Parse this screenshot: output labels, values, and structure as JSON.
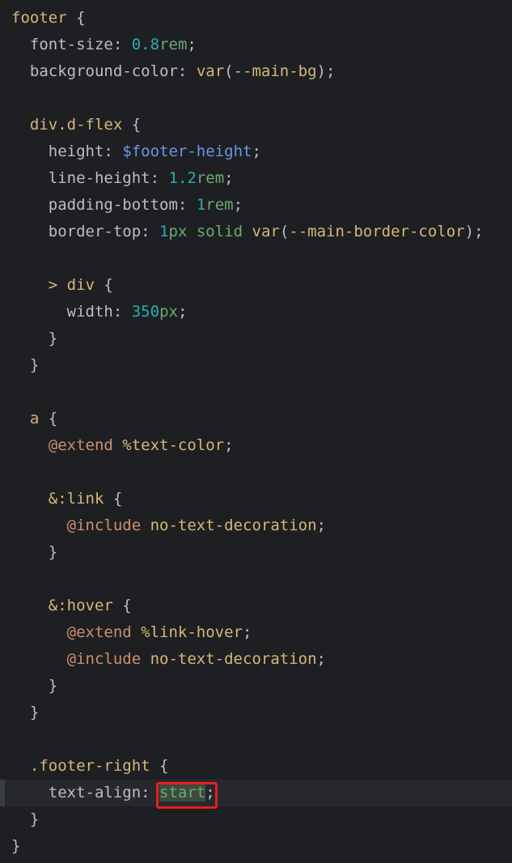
{
  "colors": {
    "background": "#1e1f22",
    "current_line": "#26282e",
    "selector": "#d5b778",
    "property": "#bcbec4",
    "number": "#2aacb8",
    "keyword_value": "#6aab73",
    "scss_variable": "#6c95eb",
    "at_rule": "#cf8e6d",
    "highlight_box": "#e8201c"
  },
  "lines": [
    {
      "indent": "",
      "tokens": [
        {
          "t": "footer",
          "c": "sel"
        },
        {
          "t": " {",
          "c": "punc"
        }
      ]
    },
    {
      "indent": "  ",
      "tokens": [
        {
          "t": "font-size",
          "c": "prop"
        },
        {
          "t": ": ",
          "c": "punc"
        },
        {
          "t": "0.8",
          "c": "num"
        },
        {
          "t": "rem",
          "c": "val"
        },
        {
          "t": ";",
          "c": "punc"
        }
      ]
    },
    {
      "indent": "  ",
      "tokens": [
        {
          "t": "background-color",
          "c": "prop"
        },
        {
          "t": ": ",
          "c": "punc"
        },
        {
          "t": "var",
          "c": "fn"
        },
        {
          "t": "(",
          "c": "punc"
        },
        {
          "t": "--main-bg",
          "c": "ident"
        },
        {
          "t": ");",
          "c": "punc"
        }
      ]
    },
    {
      "indent": "",
      "tokens": []
    },
    {
      "indent": "  ",
      "tokens": [
        {
          "t": "div.d-flex",
          "c": "sel"
        },
        {
          "t": " {",
          "c": "punc"
        }
      ]
    },
    {
      "indent": "    ",
      "tokens": [
        {
          "t": "height",
          "c": "prop"
        },
        {
          "t": ": ",
          "c": "punc"
        },
        {
          "t": "$footer-height",
          "c": "var"
        },
        {
          "t": ";",
          "c": "punc"
        }
      ]
    },
    {
      "indent": "    ",
      "tokens": [
        {
          "t": "line-height",
          "c": "prop"
        },
        {
          "t": ": ",
          "c": "punc"
        },
        {
          "t": "1.2",
          "c": "num"
        },
        {
          "t": "rem",
          "c": "val"
        },
        {
          "t": ";",
          "c": "punc"
        }
      ]
    },
    {
      "indent": "    ",
      "tokens": [
        {
          "t": "padding-bottom",
          "c": "prop"
        },
        {
          "t": ": ",
          "c": "punc"
        },
        {
          "t": "1",
          "c": "num"
        },
        {
          "t": "rem",
          "c": "val"
        },
        {
          "t": ";",
          "c": "punc"
        }
      ]
    },
    {
      "indent": "    ",
      "tokens": [
        {
          "t": "border-top",
          "c": "prop"
        },
        {
          "t": ": ",
          "c": "punc"
        },
        {
          "t": "1",
          "c": "num"
        },
        {
          "t": "px",
          "c": "val"
        },
        {
          "t": " ",
          "c": "punc"
        },
        {
          "t": "solid",
          "c": "val"
        },
        {
          "t": " ",
          "c": "punc"
        },
        {
          "t": "var",
          "c": "fn"
        },
        {
          "t": "(",
          "c": "punc"
        },
        {
          "t": "--main-border-color",
          "c": "ident"
        },
        {
          "t": ");",
          "c": "punc"
        }
      ]
    },
    {
      "indent": "",
      "tokens": []
    },
    {
      "indent": "    ",
      "tokens": [
        {
          "t": "> div",
          "c": "sel"
        },
        {
          "t": " {",
          "c": "punc"
        }
      ]
    },
    {
      "indent": "      ",
      "tokens": [
        {
          "t": "width",
          "c": "prop"
        },
        {
          "t": ": ",
          "c": "punc"
        },
        {
          "t": "350",
          "c": "num"
        },
        {
          "t": "px",
          "c": "val"
        },
        {
          "t": ";",
          "c": "punc"
        }
      ]
    },
    {
      "indent": "    ",
      "tokens": [
        {
          "t": "}",
          "c": "punc"
        }
      ]
    },
    {
      "indent": "  ",
      "tokens": [
        {
          "t": "}",
          "c": "punc"
        }
      ]
    },
    {
      "indent": "",
      "tokens": []
    },
    {
      "indent": "  ",
      "tokens": [
        {
          "t": "a",
          "c": "sel"
        },
        {
          "t": " {",
          "c": "punc"
        }
      ]
    },
    {
      "indent": "    ",
      "tokens": [
        {
          "t": "@extend",
          "c": "at"
        },
        {
          "t": " ",
          "c": "punc"
        },
        {
          "t": "%text-color",
          "c": "sel"
        },
        {
          "t": ";",
          "c": "punc"
        }
      ]
    },
    {
      "indent": "",
      "tokens": []
    },
    {
      "indent": "    ",
      "tokens": [
        {
          "t": "&:link",
          "c": "sel"
        },
        {
          "t": " {",
          "c": "punc"
        }
      ]
    },
    {
      "indent": "      ",
      "tokens": [
        {
          "t": "@include",
          "c": "at"
        },
        {
          "t": " ",
          "c": "punc"
        },
        {
          "t": "no-text-decoration",
          "c": "fn"
        },
        {
          "t": ";",
          "c": "punc"
        }
      ]
    },
    {
      "indent": "    ",
      "tokens": [
        {
          "t": "}",
          "c": "punc"
        }
      ]
    },
    {
      "indent": "",
      "tokens": []
    },
    {
      "indent": "    ",
      "tokens": [
        {
          "t": "&:hover",
          "c": "sel"
        },
        {
          "t": " {",
          "c": "punc"
        }
      ]
    },
    {
      "indent": "      ",
      "tokens": [
        {
          "t": "@extend",
          "c": "at"
        },
        {
          "t": " ",
          "c": "punc"
        },
        {
          "t": "%link-hover",
          "c": "sel"
        },
        {
          "t": ";",
          "c": "punc"
        }
      ]
    },
    {
      "indent": "      ",
      "tokens": [
        {
          "t": "@include",
          "c": "at"
        },
        {
          "t": " ",
          "c": "punc"
        },
        {
          "t": "no-text-decoration",
          "c": "fn"
        },
        {
          "t": ";",
          "c": "punc"
        }
      ]
    },
    {
      "indent": "    ",
      "tokens": [
        {
          "t": "}",
          "c": "punc"
        }
      ]
    },
    {
      "indent": "  ",
      "tokens": [
        {
          "t": "}",
          "c": "punc"
        }
      ]
    },
    {
      "indent": "",
      "tokens": []
    },
    {
      "indent": "  ",
      "tokens": [
        {
          "t": ".footer-right",
          "c": "sel"
        },
        {
          "t": " {",
          "c": "punc"
        }
      ]
    },
    {
      "indent": "    ",
      "current": true,
      "tokens": [
        {
          "t": "text-align",
          "c": "prop"
        },
        {
          "t": ": ",
          "c": "punc"
        },
        {
          "t": "start",
          "c": "val",
          "boxed": true
        },
        {
          "t": ";",
          "c": "punc"
        }
      ]
    },
    {
      "indent": "  ",
      "tokens": [
        {
          "t": "}",
          "c": "punc"
        }
      ]
    },
    {
      "indent": "",
      "tokens": [
        {
          "t": "}",
          "c": "punc"
        }
      ]
    }
  ]
}
